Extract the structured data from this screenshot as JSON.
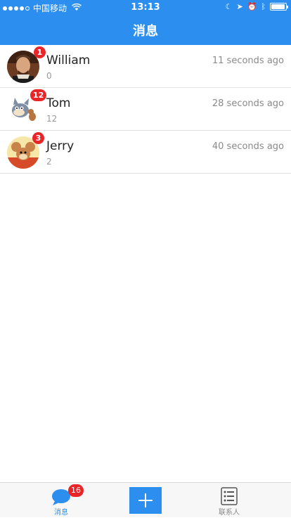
{
  "status_bar": {
    "carrier": "中国移动",
    "time": "13:13",
    "battery_level": 0.9,
    "signal_bars": 4,
    "icons": [
      "wifi-icon",
      "moon-icon",
      "location-icon",
      "alarm-icon",
      "bluetooth-icon",
      "battery-icon"
    ]
  },
  "header": {
    "title": "消息",
    "background": "#2c8ff0"
  },
  "conversations": [
    {
      "name": "William",
      "preview": "0",
      "time_ago": "11 seconds ago",
      "unread": "1",
      "avatar": "shakespeare-portrait"
    },
    {
      "name": "Tom",
      "preview": "12",
      "time_ago": "28 seconds ago",
      "unread": "12",
      "avatar": "tom-cat"
    },
    {
      "name": "Jerry",
      "preview": "2",
      "time_ago": "40 seconds ago",
      "unread": "3",
      "avatar": "jerry-mouse"
    }
  ],
  "tabbar": {
    "messages_label": "消息",
    "messages_badge": "16",
    "add_icon": "plus-icon",
    "contacts_label": "联系人",
    "active_color": "#2c8ff0",
    "badge_color": "#e8262a"
  }
}
